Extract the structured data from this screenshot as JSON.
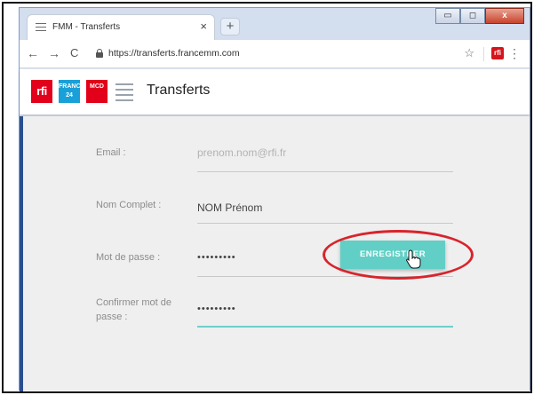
{
  "browser": {
    "tab_title": "FMM - Transferts",
    "tab_close": "×",
    "new_tab": "+",
    "url": "https://transferts.francemm.com",
    "window_buttons": {
      "minimize": "▭",
      "maximize": "◻",
      "close": "x"
    }
  },
  "header": {
    "logos": {
      "rfi": "rfi",
      "france24": "FRANCE 24",
      "mcd": "MCD"
    },
    "title": "Transferts"
  },
  "form": {
    "email": {
      "label": "Email :",
      "placeholder": "prenom.nom@rfi.fr"
    },
    "fullname": {
      "label": "Nom Complet :",
      "value": "NOM Prénom"
    },
    "password": {
      "label": "Mot de passe :",
      "value": "•••••••••"
    },
    "confirm": {
      "label": "Confirmer mot de passe :",
      "value": "•••••••••"
    },
    "submit_label": "ENREGISTRER"
  },
  "colors": {
    "accent": "#62cfc6",
    "highlight_ring": "#d8242c",
    "rfi_red": "#e2001a"
  }
}
